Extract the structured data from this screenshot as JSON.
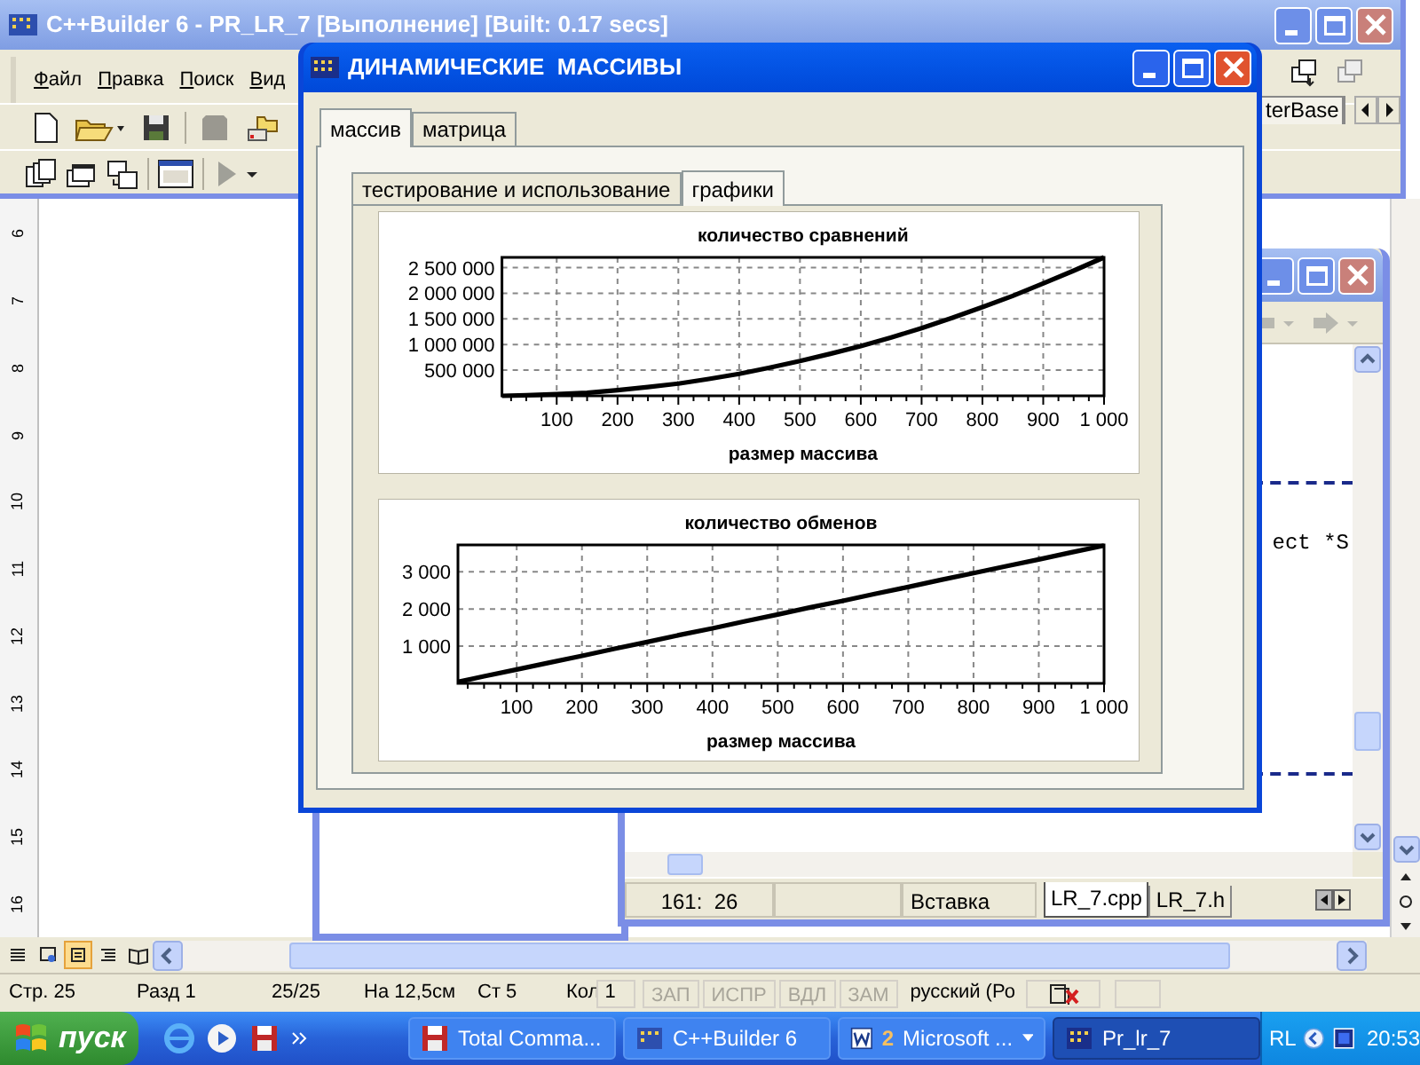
{
  "word": {
    "ruler": [
      "6",
      "7",
      "8",
      "9",
      "10",
      "11",
      "12",
      "13",
      "14",
      "15",
      "16"
    ],
    "views": [
      {
        "kind": "normal",
        "selected": false
      },
      {
        "kind": "web",
        "selected": false
      },
      {
        "kind": "print",
        "selected": true
      },
      {
        "kind": "outline",
        "selected": false
      },
      {
        "kind": "reading",
        "selected": false
      }
    ],
    "status_bar": [
      {
        "kind": "text",
        "label": "Стр. 25"
      },
      {
        "kind": "text",
        "label": "Разд 1"
      },
      {
        "kind": "text",
        "label": "25/25"
      },
      {
        "kind": "text",
        "label": "На 12,5см"
      },
      {
        "kind": "text",
        "label": "Ст 5"
      },
      {
        "kind": "text",
        "label": "Кол 1"
      },
      {
        "kind": "indicator",
        "label": "ЗАП",
        "on": false
      },
      {
        "kind": "indicator",
        "label": "ИСПР",
        "on": false
      },
      {
        "kind": "indicator",
        "label": "ВДЛ",
        "on": false
      },
      {
        "kind": "indicator",
        "label": "ЗАМ",
        "on": false
      },
      {
        "kind": "text",
        "label": "русский (Ро"
      }
    ]
  },
  "builder": {
    "title": "C++Builder 6 - PR_LR_7 [Выполнение] [Built: 0.17 secs]",
    "menu": [
      "Файл",
      "Правка",
      "Поиск",
      "Вид"
    ],
    "palette_tab": "terBase"
  },
  "editor": {
    "code": "ect *S",
    "position": "161:  26",
    "mode": "Вставка",
    "tabs": [
      {
        "label": "LR_7.cpp",
        "selected": true
      },
      {
        "label": "LR_7.h",
        "selected": false
      }
    ]
  },
  "dialog": {
    "title": "ДИНАМИЧЕСКИЕ  МАССИВЫ",
    "tabs": [
      {
        "label": "массив",
        "selected": true
      },
      {
        "label": "матрица",
        "selected": false
      }
    ],
    "subtabs": [
      {
        "label": "тестирование и использование",
        "selected": false
      },
      {
        "label": "графики",
        "selected": true
      }
    ],
    "charts": [
      {
        "chart_data": {
          "type": "line",
          "title": "количество сравнений",
          "xlabel": "размер массива",
          "x": [
            10,
            50,
            100,
            150,
            200,
            250,
            300,
            350,
            400,
            450,
            500,
            550,
            600,
            650,
            700,
            750,
            800,
            850,
            900,
            950,
            1000
          ],
          "series": [
            {
              "color": "#000000",
              "values": [
                0,
                10000,
                30000,
                60000,
                110000,
                170000,
                240000,
                330000,
                430000,
                550000,
                680000,
                820000,
                970000,
                1140000,
                1320000,
                1520000,
                1730000,
                1950000,
                2190000,
                2440000,
                2700000
              ]
            }
          ],
          "grid": true,
          "xlim": [
            10,
            1000
          ],
          "ylim": [
            0,
            2700000
          ],
          "xticks": [
            100,
            200,
            300,
            400,
            500,
            600,
            700,
            800,
            900,
            {
              "value": 1000,
              "label": "1 000"
            }
          ],
          "yticks": [
            {
              "value": 500000,
              "label": "500 000"
            },
            {
              "value": 1000000,
              "label": "1 000 000"
            },
            {
              "value": 1500000,
              "label": "1 500 000"
            },
            {
              "value": 2000000,
              "label": "2 000 000"
            },
            {
              "value": 2500000,
              "label": "2 500 000"
            }
          ]
        }
      },
      {
        "chart_data": {
          "type": "line",
          "title": "количество обменов",
          "xlabel": "размер массива",
          "x": [
            10,
            50,
            100,
            150,
            200,
            250,
            300,
            350,
            400,
            450,
            500,
            550,
            600,
            650,
            700,
            750,
            800,
            850,
            900,
            950,
            1000
          ],
          "series": [
            {
              "color": "#000000",
              "values": [
                40,
                190,
                370,
                560,
                740,
                930,
                1110,
                1300,
                1480,
                1670,
                1850,
                2040,
                2220,
                2410,
                2590,
                2780,
                2960,
                3150,
                3330,
                3520,
                3700
              ]
            }
          ],
          "grid": true,
          "xlim": [
            10,
            1000
          ],
          "ylim": [
            0,
            3720
          ],
          "xticks": [
            100,
            200,
            300,
            400,
            500,
            600,
            700,
            800,
            900,
            {
              "value": 1000,
              "label": "1 000"
            }
          ],
          "yticks": [
            {
              "value": 1000,
              "label": "1 000"
            },
            {
              "value": 2000,
              "label": "2 000"
            },
            {
              "value": 3000,
              "label": "3 000"
            }
          ]
        }
      }
    ]
  },
  "taskbar": {
    "start": "пуск",
    "quick_launch": [
      {
        "kind": "browser"
      },
      {
        "kind": "media"
      },
      {
        "kind": "disk"
      }
    ],
    "buttons": [
      {
        "kind": "disk",
        "label": "Total Comma...",
        "selected": false
      },
      {
        "kind": "builder",
        "label": "C++Builder 6",
        "selected": false
      },
      {
        "kind": "word",
        "count": "2",
        "label": "Microsoft ...",
        "selected": false
      },
      {
        "kind": "app",
        "label": "Pr_lr_7",
        "selected": true
      }
    ],
    "language": "RL",
    "clock": "20:53"
  }
}
